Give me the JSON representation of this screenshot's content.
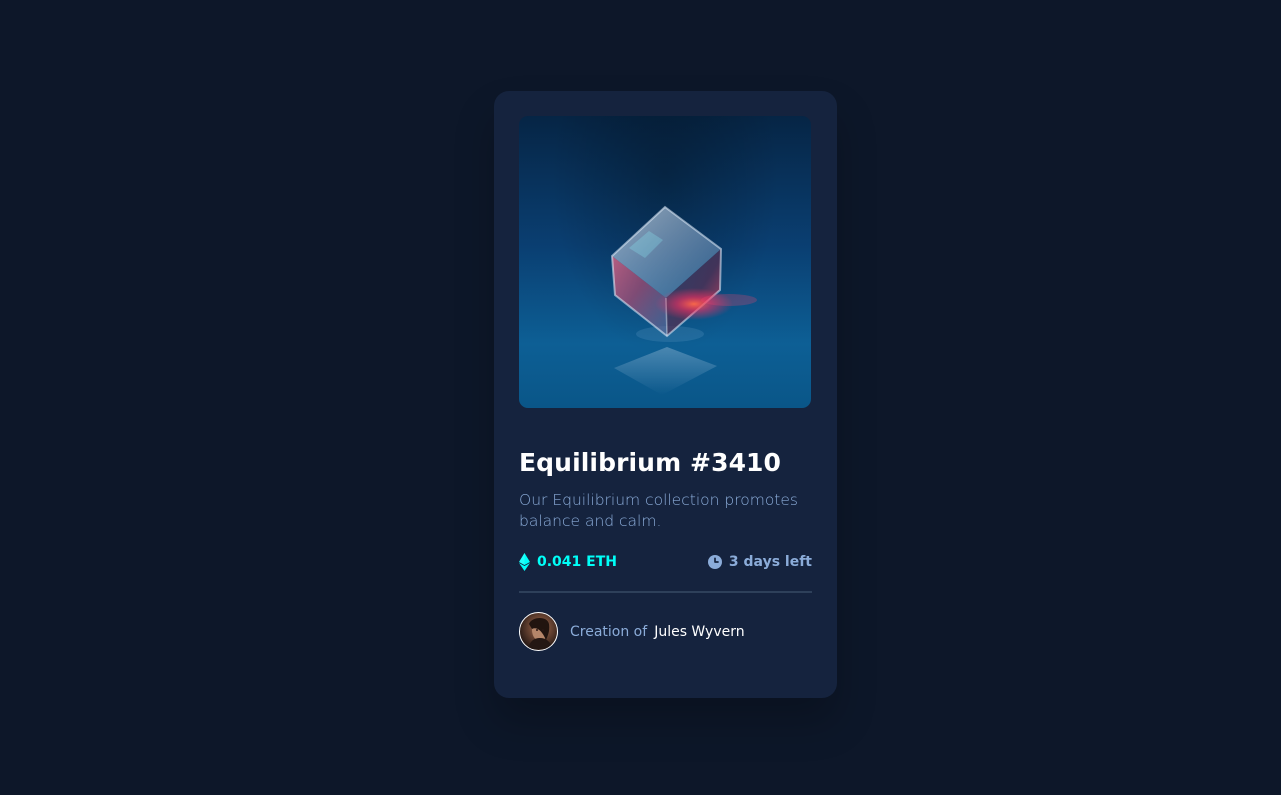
{
  "card": {
    "title": "Equilibrium #3410",
    "description": "Our Equilibrium collection promotes balance and calm.",
    "price": "0.041 ETH",
    "time_left": "3 days left",
    "creator_prefix": "Creation of",
    "creator_name": "Jules Wyvern"
  },
  "icons": {
    "price_icon": "ethereum-icon",
    "time_icon": "clock-icon"
  },
  "colors": {
    "page_background": "#0d1729",
    "card_background": "#15233e",
    "accent_cyan": "#00fff8",
    "soft_blue": "#8bacd9",
    "white": "#ffffff",
    "divider": "#2e405a"
  }
}
